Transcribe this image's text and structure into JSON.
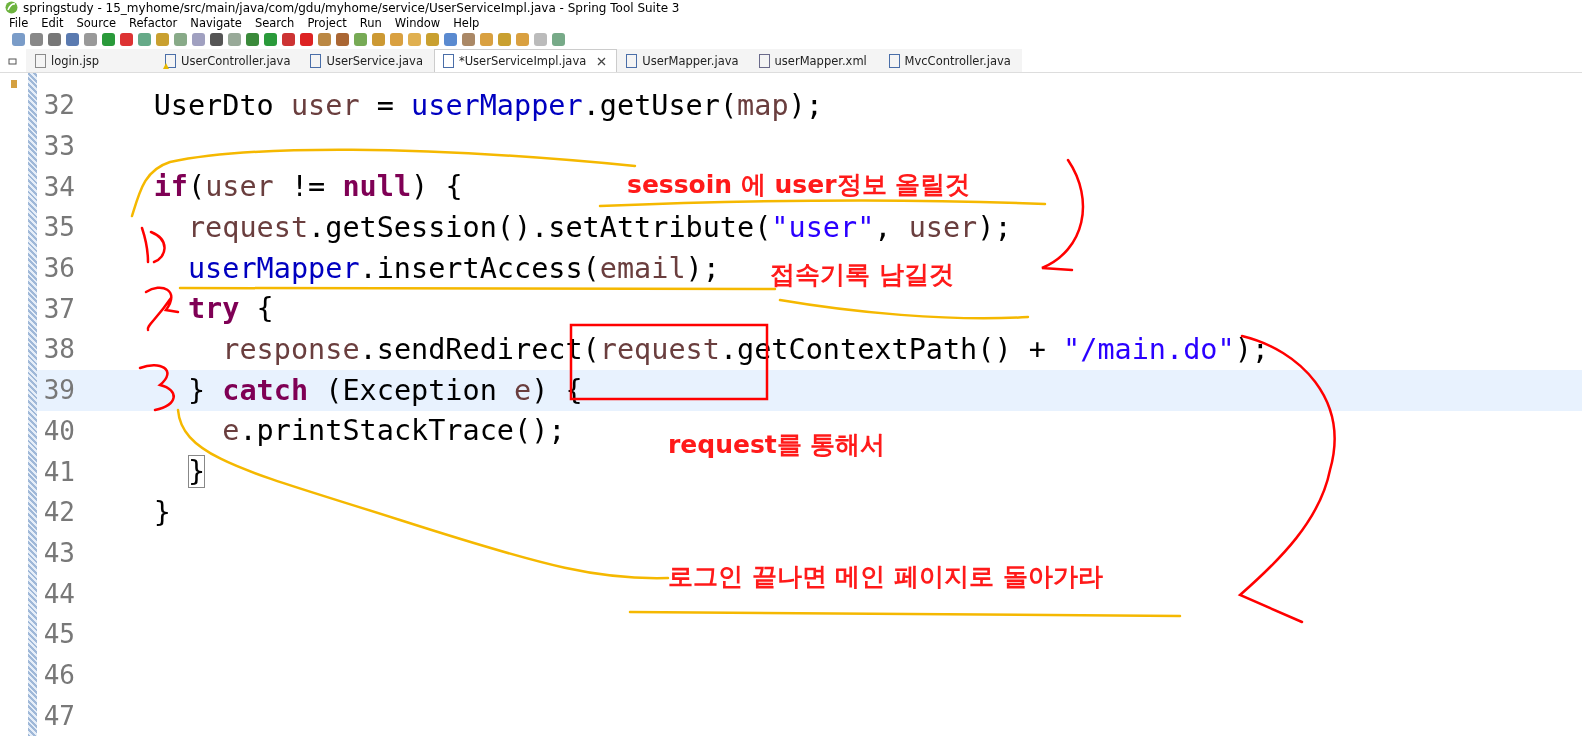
{
  "window": {
    "title": "springstudy - 15_myhome/src/main/java/com/gdu/myhome/service/UserServiceImpl.java - Spring Tool Suite 3"
  },
  "menu": [
    "File",
    "Edit",
    "Source",
    "Refactor",
    "Navigate",
    "Search",
    "Project",
    "Run",
    "Window",
    "Help"
  ],
  "tabs": [
    {
      "label": "login.jsp",
      "kind": "jsp",
      "selected": false
    },
    {
      "label": "UserController.java",
      "kind": "java-warning",
      "selected": false
    },
    {
      "label": "UserService.java",
      "kind": "java",
      "selected": false
    },
    {
      "label": "*UserServiceImpl.java",
      "kind": "java",
      "selected": true
    },
    {
      "label": "UserMapper.java",
      "kind": "java",
      "selected": false
    },
    {
      "label": "userMapper.xml",
      "kind": "xml",
      "selected": false
    },
    {
      "label": "MvcController.java",
      "kind": "java",
      "selected": false
    }
  ],
  "editor": {
    "lines": [
      {
        "number": "32",
        "current": false,
        "tokens": [
          {
            "text": "    UserDto ",
            "kind": "plain"
          },
          {
            "text": "user",
            "kind": "variable"
          },
          {
            "text": " = ",
            "kind": "plain"
          },
          {
            "text": "userMapper",
            "kind": "field"
          },
          {
            "text": ".getUser(",
            "kind": "plain"
          },
          {
            "text": "map",
            "kind": "variable"
          },
          {
            "text": ");",
            "kind": "plain"
          }
        ]
      },
      {
        "number": "33",
        "current": false
      },
      {
        "number": "34",
        "current": false,
        "tokens": [
          {
            "text": "    if",
            "kind": "keyword"
          },
          {
            "text": "(",
            "kind": "plain"
          },
          {
            "text": "user",
            "kind": "variable"
          },
          {
            "text": " != ",
            "kind": "plain"
          },
          {
            "text": "null",
            "kind": "keyword"
          },
          {
            "text": ") {",
            "kind": "plain"
          }
        ]
      },
      {
        "number": "35",
        "current": false,
        "tokens": [
          {
            "text": "      request",
            "kind": "variable"
          },
          {
            "text": ".getSession().setAttribute(",
            "kind": "plain"
          },
          {
            "text": "\"user\"",
            "kind": "string"
          },
          {
            "text": ", ",
            "kind": "plain"
          },
          {
            "text": "user",
            "kind": "variable"
          },
          {
            "text": ");",
            "kind": "plain"
          }
        ]
      },
      {
        "number": "36",
        "current": false,
        "tokens": [
          {
            "text": "      userMapper",
            "kind": "field"
          },
          {
            "text": ".insertAccess(",
            "kind": "plain"
          },
          {
            "text": "email",
            "kind": "variable"
          },
          {
            "text": ");",
            "kind": "plain"
          }
        ]
      },
      {
        "number": "37",
        "current": false,
        "tokens": [
          {
            "text": "      try",
            "kind": "keyword"
          },
          {
            "text": " {",
            "kind": "plain"
          }
        ]
      },
      {
        "number": "38",
        "current": false,
        "tokens": [
          {
            "text": "        response",
            "kind": "variable"
          },
          {
            "text": ".sendRedirect(",
            "kind": "plain"
          },
          {
            "text": "request",
            "kind": "variable"
          },
          {
            "text": ".getContextPath() + ",
            "kind": "plain"
          },
          {
            "text": "\"/main.do\"",
            "kind": "string"
          },
          {
            "text": ");",
            "kind": "plain"
          }
        ]
      },
      {
        "number": "39",
        "current": true,
        "tokens": [
          {
            "text": "      } ",
            "kind": "plain"
          },
          {
            "text": "catch",
            "kind": "keyword"
          },
          {
            "text": " (Exception ",
            "kind": "plain"
          },
          {
            "text": "e",
            "kind": "variable"
          },
          {
            "text": ") {",
            "kind": "plain"
          }
        ]
      },
      {
        "number": "40",
        "current": false,
        "tokens": [
          {
            "text": "        e",
            "kind": "variable"
          },
          {
            "text": ".printStackTrace();",
            "kind": "plain"
          }
        ]
      },
      {
        "number": "41",
        "current": false,
        "tokens": [
          {
            "text": "      }",
            "kind": "bracket-match"
          }
        ]
      },
      {
        "number": "42",
        "current": false,
        "tokens": [
          {
            "text": "    }",
            "kind": "plain"
          }
        ]
      },
      {
        "number": "43",
        "current": false
      },
      {
        "number": "44",
        "current": false
      },
      {
        "number": "45",
        "current": false
      },
      {
        "number": "46",
        "current": false
      },
      {
        "number": "47",
        "current": false
      }
    ]
  },
  "annotations": [
    {
      "text": "sessoin 에 user정보 올릴것",
      "kind": "note"
    },
    {
      "text": "접속기록 남길것",
      "kind": "note"
    },
    {
      "text": "request를 통해서",
      "kind": "note"
    },
    {
      "text": "로그인 끝나면 메인 페이지로 돌아가라",
      "kind": "note"
    }
  ]
}
